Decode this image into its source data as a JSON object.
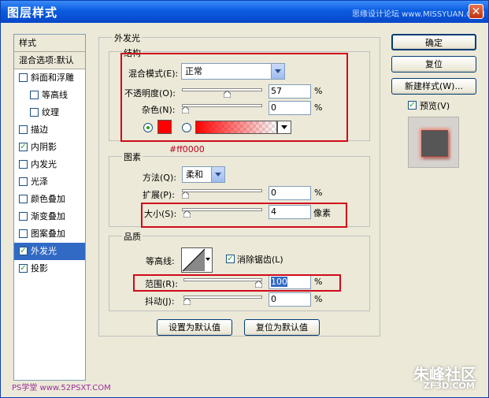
{
  "window": {
    "title": "图层样式",
    "watermark_top": "思缘设计论坛 www.MISSYUAN.COM",
    "close_glyph": "✕"
  },
  "left": {
    "header": "样式",
    "blend_options": "混合选项:默认",
    "items": [
      {
        "label": "斜面和浮雕",
        "checked": false
      },
      {
        "label": "等高线",
        "checked": false
      },
      {
        "label": "纹理",
        "checked": false
      },
      {
        "label": "描边",
        "checked": false
      },
      {
        "label": "内阴影",
        "checked": true
      },
      {
        "label": "内发光",
        "checked": false
      },
      {
        "label": "光泽",
        "checked": false
      },
      {
        "label": "颜色叠加",
        "checked": false
      },
      {
        "label": "渐变叠加",
        "checked": false
      },
      {
        "label": "图案叠加",
        "checked": false
      },
      {
        "label": "外发光",
        "checked": true
      },
      {
        "label": "投影",
        "checked": true
      }
    ]
  },
  "outer_glow": {
    "section_title": "外发光",
    "structure": {
      "title": "结构",
      "blend_mode_label": "混合模式(E):",
      "blend_mode_value": "正常",
      "opacity_label": "不透明度(O):",
      "opacity_value": "57",
      "opacity_fraction": 0.57,
      "noise_label": "杂色(N):",
      "noise_value": "0",
      "noise_fraction": 0,
      "unit": "%",
      "color_hex": "#ff0000",
      "color_note": "#ff0000"
    },
    "elements": {
      "title": "图素",
      "technique_label": "方法(Q):",
      "technique_value": "柔和",
      "spread_label": "扩展(P):",
      "spread_value": "0",
      "spread_fraction": 0,
      "size_label": "大小(S):",
      "size_value": "4",
      "size_fraction": 0.02,
      "size_unit": "像素",
      "unit": "%"
    },
    "quality": {
      "title": "品质",
      "contour_label": "等高线:",
      "antialias_label": "消除锯齿(L)",
      "antialias_checked": true,
      "range_label": "范围(R):",
      "range_value": "100",
      "range_fraction": 1,
      "jitter_label": "抖动(J):",
      "jitter_value": "0",
      "jitter_fraction": 0,
      "unit": "%"
    },
    "make_default": "设置为默认值",
    "reset_default": "复位为默认值"
  },
  "right": {
    "ok": "确定",
    "reset": "复位",
    "new_style": "新建样式(W)...",
    "preview_label": "预览(V)",
    "preview_checked": true
  },
  "watermarks": {
    "bottom_left": "PS学堂 www.52PSXT.COM",
    "bottom_right": "朱峰社区",
    "bottom_right_sub": "ZF3D.COM"
  },
  "colors": {
    "accent": "#316ac5",
    "highlight": "#d00a1a",
    "glow": "#ff0000"
  }
}
